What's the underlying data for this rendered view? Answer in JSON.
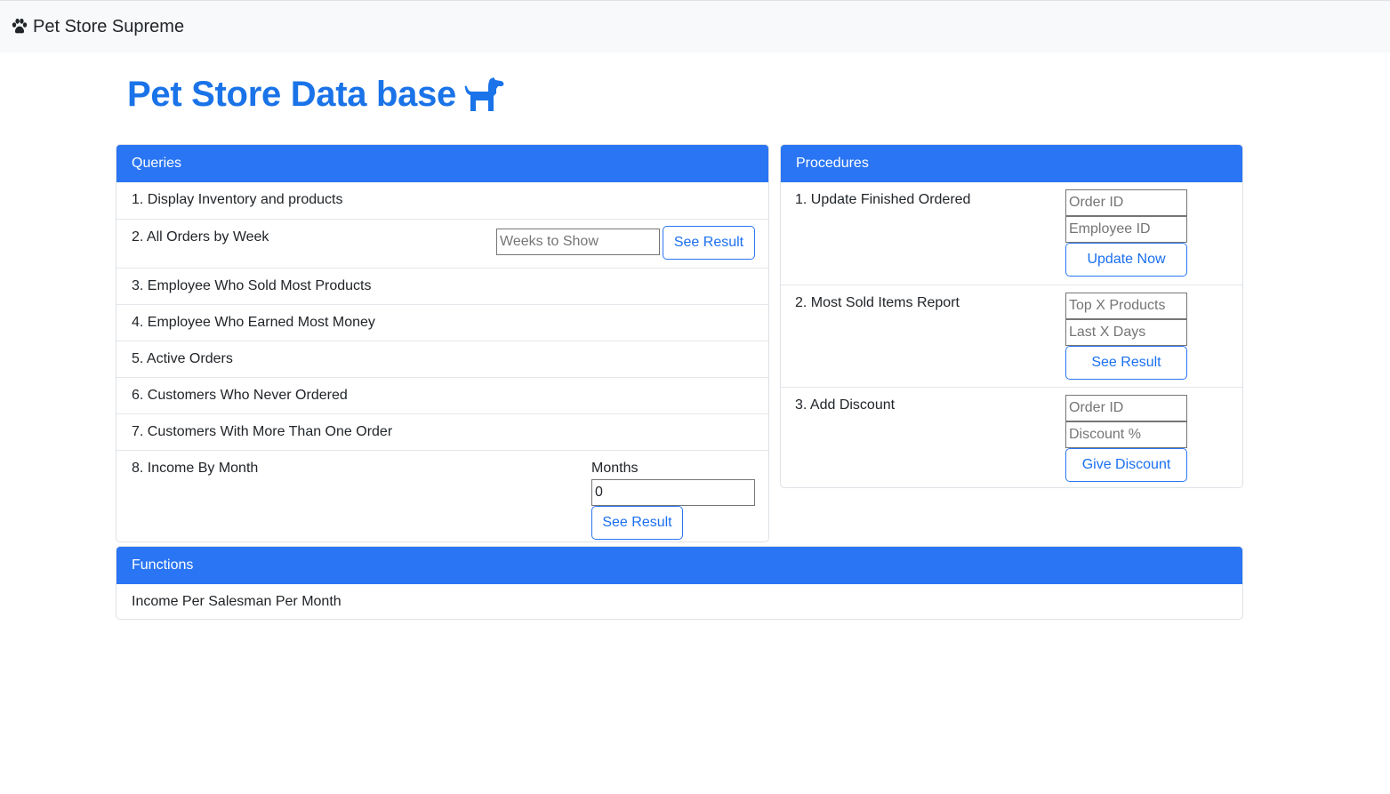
{
  "navbar": {
    "brand": "Pet Store Supreme",
    "brand_icon": "paw-icon"
  },
  "page": {
    "title": "Pet Store Data base",
    "title_icon": "dog-icon",
    "accent": "#2a75f3"
  },
  "queries": {
    "header": "Queries",
    "items": [
      {
        "label": "1. Display Inventory and products"
      },
      {
        "label": "2. All Orders by Week",
        "input_placeholder": "Weeks to Show",
        "button": "See Result"
      },
      {
        "label": "3. Employee Who Sold Most Products"
      },
      {
        "label": "4. Employee Who Earned Most Money"
      },
      {
        "label": "5. Active Orders"
      },
      {
        "label": "6. Customers Who Never Ordered"
      },
      {
        "label": "7. Customers With More Than One Order"
      },
      {
        "label": "8. Income By Month",
        "field_label": "Months",
        "input_value": "0",
        "button": "See Result"
      }
    ]
  },
  "procedures": {
    "header": "Procedures",
    "items": [
      {
        "label": "1. Update Finished Ordered",
        "input1_placeholder": "Order ID",
        "input2_placeholder": "Employee ID",
        "button": "Update Now"
      },
      {
        "label": "2. Most Sold Items Report",
        "input1_placeholder": "Top X Products",
        "input2_placeholder": "Last X Days",
        "button": "See Result"
      },
      {
        "label": "3. Add Discount",
        "input1_placeholder": "Order ID",
        "input2_placeholder": "Discount %",
        "button": "Give Discount"
      }
    ]
  },
  "functions": {
    "header": "Functions",
    "items": [
      {
        "label": "Income Per Salesman Per Month"
      }
    ]
  }
}
